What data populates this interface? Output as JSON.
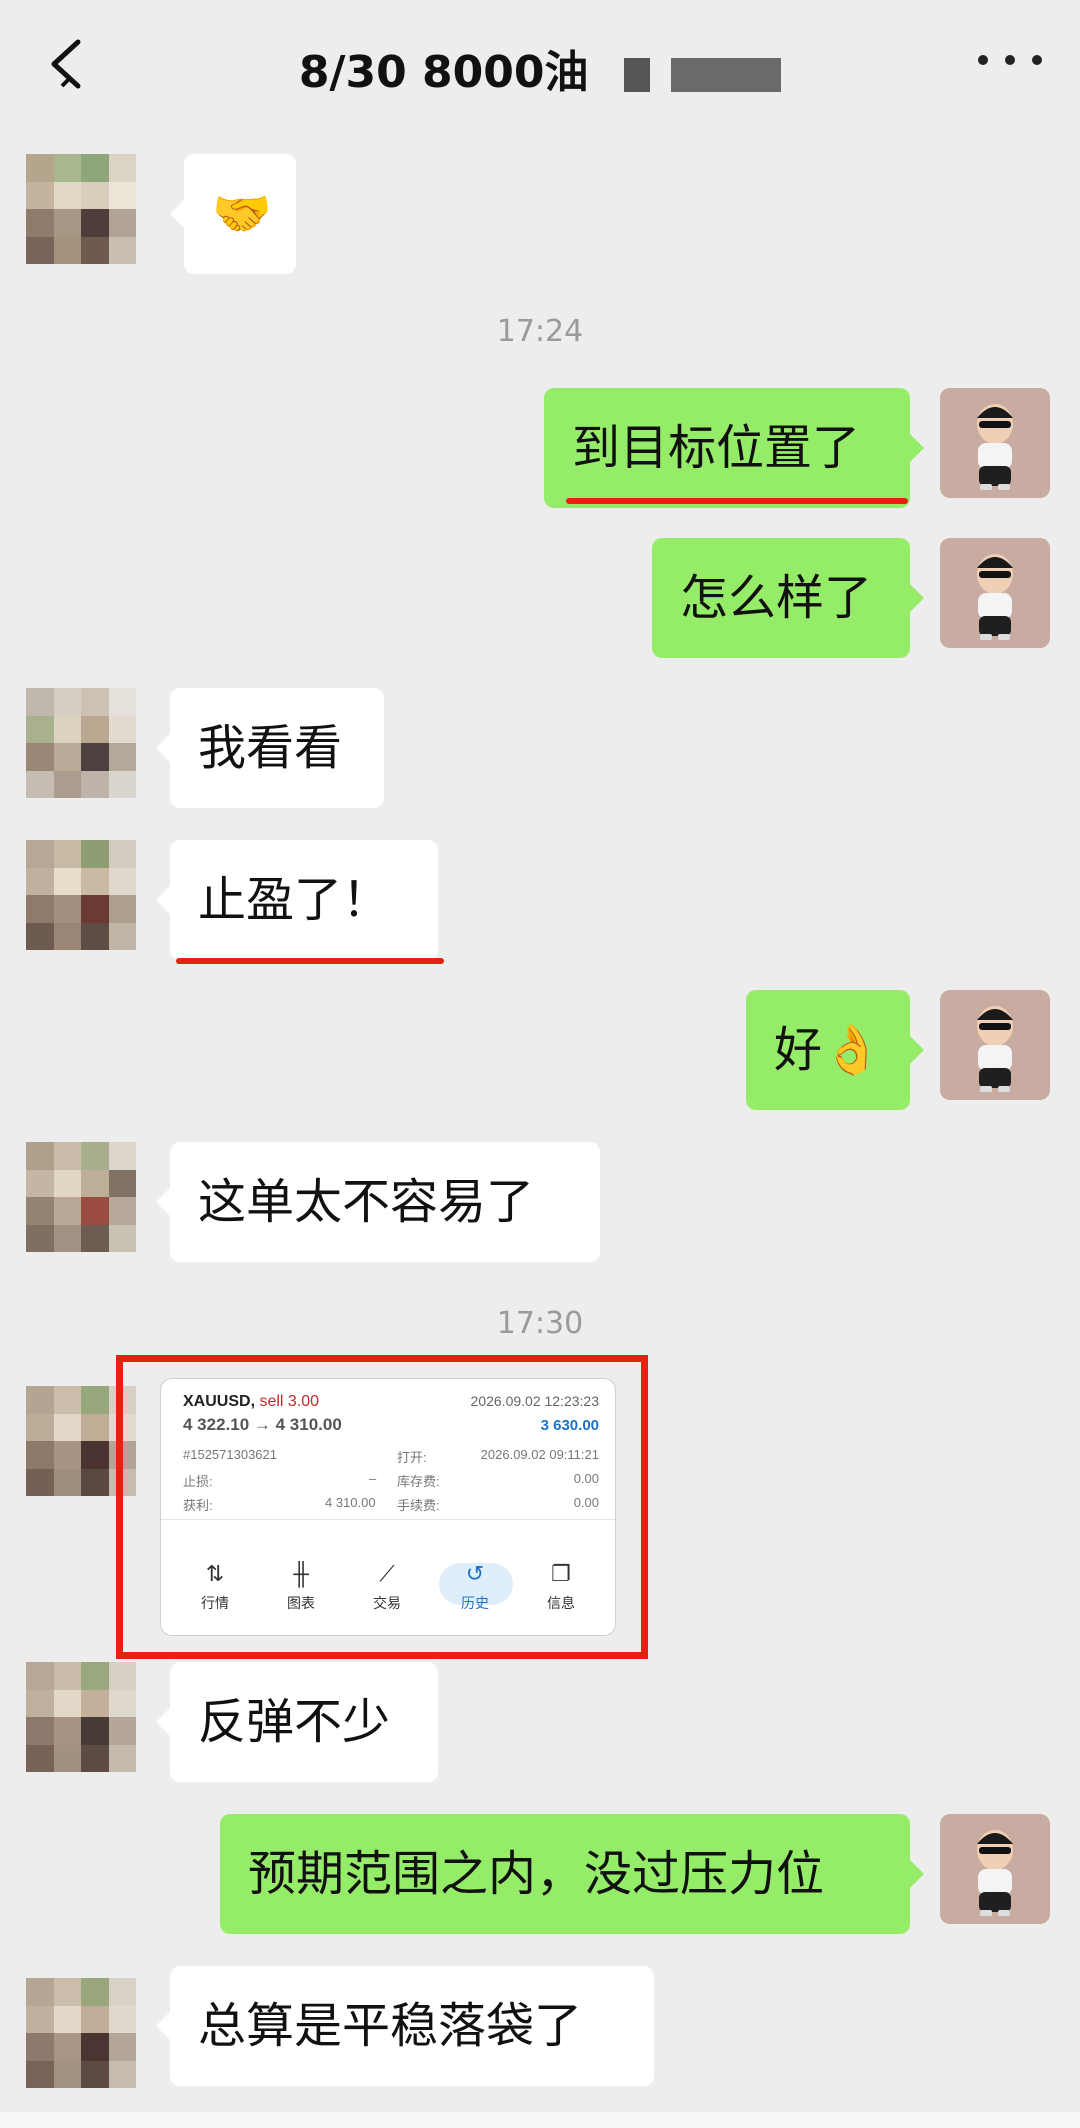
{
  "header": {
    "title": "8/30  8000油",
    "title_masked": "7▆ ▆▆▆"
  },
  "messages": {
    "m1": "🤝",
    "t1": "17:24",
    "m2": "到目标位置了",
    "m3": "怎么样了",
    "m4": "我看看",
    "m5": "止盈了！",
    "m6": "好👌",
    "m7": "这单太不容易了",
    "t2": "17:30",
    "m8": "反弹不少",
    "m9": "预期范围之内，没过压力位",
    "m10": "总算是平稳落袋了"
  },
  "trade_card": {
    "symbol": "XAUUSD,",
    "side": "sell 3.00",
    "price_line": "4 322.10 → 4 310.00",
    "close_time": "2026.09.02 12:23:23",
    "profit": "3 630.00",
    "order_id": "#152571303621",
    "open_label": "打开:",
    "open_time": "2026.09.02 09:11:21",
    "sl_label": "止损:",
    "sl_value": "–",
    "swap_label": "库存费:",
    "swap_value": "0.00",
    "tp_label": "获利:",
    "tp_value": "4 310.00",
    "fee_label": "手续费:",
    "fee_value": "0.00",
    "tabs": [
      "行情",
      "图表",
      "交易",
      "历史",
      "信息"
    ],
    "active_tab": "历史"
  },
  "colors": {
    "background": "#ededed",
    "green_bubble": "#95ec69",
    "white_bubble": "#ffffff",
    "highlight_red": "#e32212",
    "profit_blue": "#1e73c8"
  }
}
